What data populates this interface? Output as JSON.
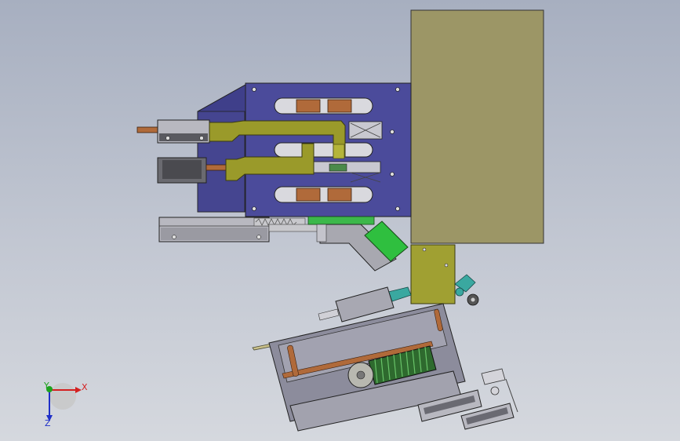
{
  "view": {
    "background_top": "#a7afc0",
    "background_bottom": "#d5d8de"
  },
  "triad": {
    "x_label": "X",
    "y_label": "Y",
    "z_label": "Z",
    "x_color": "#d42020",
    "y_color": "#1fa21f",
    "z_color": "#1f2fc8"
  },
  "colors": {
    "base_plate": "#4a4a9a",
    "cabinet": "#9c9666",
    "arm": "#9a9a2a",
    "gray_block": "#a8a8b0",
    "copper": "#b06a3a",
    "bright_green": "#2fbf3f",
    "teal": "#3aa8a0",
    "dark_green": "#2e6a2e"
  },
  "icons": {
    "triad": "coordinate-triad-icon"
  }
}
